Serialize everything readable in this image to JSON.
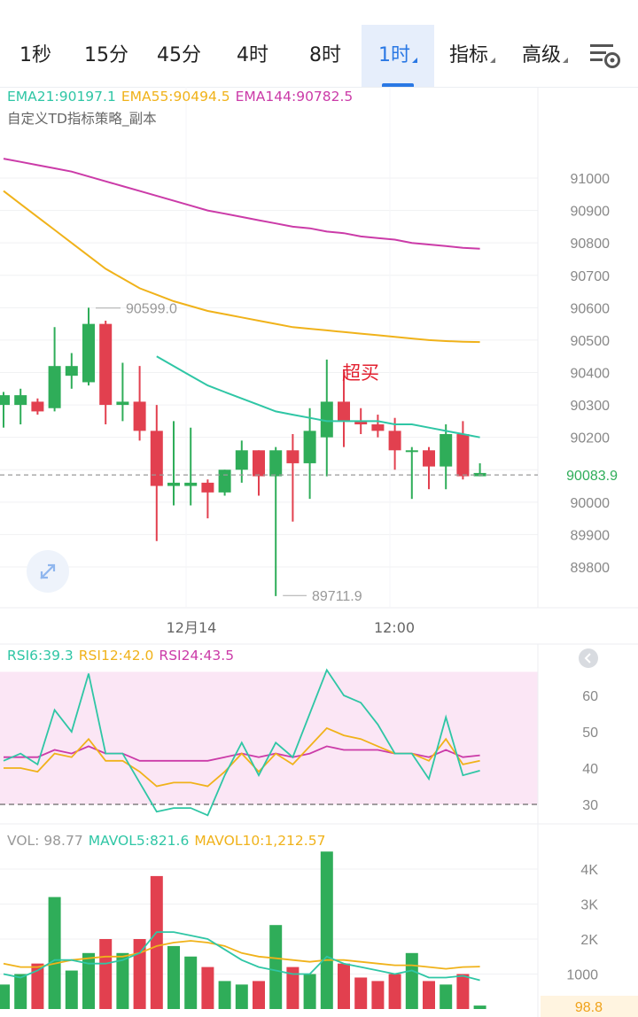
{
  "tabs": [
    {
      "label": "1秒",
      "active": false,
      "dropdown": false
    },
    {
      "label": "15分",
      "active": false,
      "dropdown": false
    },
    {
      "label": "45分",
      "active": false,
      "dropdown": false
    },
    {
      "label": "4时",
      "active": false,
      "dropdown": false
    },
    {
      "label": "8时",
      "active": false,
      "dropdown": false
    },
    {
      "label": "1时",
      "active": true,
      "dropdown": true
    },
    {
      "label": "指标",
      "active": false,
      "dropdown": true
    },
    {
      "label": "高级",
      "active": false,
      "dropdown": true
    }
  ],
  "settings_icon": "chart-settings-icon",
  "main_legend": {
    "ema21": "EMA21:90197.1",
    "ema55": "EMA55:90494.5",
    "ema144": "EMA144:90782.5",
    "strategy": "自定义TD指标策略_副本"
  },
  "colors": {
    "up": "#2fad59",
    "down": "#e2404f",
    "ema21": "#2fc6a5",
    "ema55": "#f0b21a",
    "ema144": "#cb3ba8",
    "accent": "#2a78e4",
    "rsi_band": "#fbe6f5"
  },
  "annotations": {
    "high_label": "90599.0",
    "low_label": "89711.9",
    "overbought": "超买",
    "last_price": "90083.9"
  },
  "x_labels": [
    "12月14",
    "12:00"
  ],
  "rsi_legend": {
    "rsi6": "RSI6:39.3",
    "rsi12": "RSI12:42.0",
    "rsi24": "RSI24:43.5"
  },
  "vol_legend": {
    "vol": "VOL: 98.77",
    "mavol5": "MAVOL5:821.6",
    "mavol10": "MAVOL10:1,212.57"
  },
  "current_volume": "98.8",
  "chart_data": {
    "type": "candlestick",
    "price_axis": {
      "ticks": [
        "91000",
        "90900",
        "90800",
        "90700",
        "90600",
        "90500",
        "90400",
        "90300",
        "90200",
        "90100",
        "90000",
        "89900",
        "89800"
      ],
      "range": [
        89650,
        91150
      ]
    },
    "candles": [
      {
        "o": 90300,
        "h": 90340,
        "l": 90230,
        "c": 90330
      },
      {
        "o": 90300,
        "h": 90350,
        "l": 90240,
        "c": 90330
      },
      {
        "o": 90310,
        "h": 90320,
        "l": 90270,
        "c": 90280
      },
      {
        "o": 90290,
        "h": 90540,
        "l": 90280,
        "c": 90420
      },
      {
        "o": 90390,
        "h": 90460,
        "l": 90350,
        "c": 90420
      },
      {
        "o": 90370,
        "h": 90600,
        "l": 90360,
        "c": 90550
      },
      {
        "o": 90550,
        "h": 90560,
        "l": 90240,
        "c": 90300
      },
      {
        "o": 90300,
        "h": 90430,
        "l": 90250,
        "c": 90310
      },
      {
        "o": 90310,
        "h": 90420,
        "l": 90190,
        "c": 90220
      },
      {
        "o": 90220,
        "h": 90300,
        "l": 89880,
        "c": 90050
      },
      {
        "o": 90050,
        "h": 90250,
        "l": 89990,
        "c": 90060
      },
      {
        "o": 90050,
        "h": 90230,
        "l": 89990,
        "c": 90060
      },
      {
        "o": 90060,
        "h": 90070,
        "l": 89950,
        "c": 90030
      },
      {
        "o": 90030,
        "h": 90100,
        "l": 90020,
        "c": 90100
      },
      {
        "o": 90100,
        "h": 90190,
        "l": 90060,
        "c": 90160
      },
      {
        "o": 90160,
        "h": 90160,
        "l": 90020,
        "c": 90080
      },
      {
        "o": 90080,
        "h": 90170,
        "l": 89710,
        "c": 90160
      },
      {
        "o": 90160,
        "h": 90210,
        "l": 89940,
        "c": 90120
      },
      {
        "o": 90120,
        "h": 90290,
        "l": 90010,
        "c": 90220
      },
      {
        "o": 90200,
        "h": 90440,
        "l": 90080,
        "c": 90310
      },
      {
        "o": 90310,
        "h": 90410,
        "l": 90170,
        "c": 90250
      },
      {
        "o": 90250,
        "h": 90290,
        "l": 90210,
        "c": 90240
      },
      {
        "o": 90240,
        "h": 90270,
        "l": 90200,
        "c": 90220
      },
      {
        "o": 90220,
        "h": 90260,
        "l": 90100,
        "c": 90160
      },
      {
        "o": 90160,
        "h": 90170,
        "l": 90010,
        "c": 90160
      },
      {
        "o": 90160,
        "h": 90170,
        "l": 90040,
        "c": 90110
      },
      {
        "o": 90110,
        "h": 90240,
        "l": 90040,
        "c": 90210
      },
      {
        "o": 90210,
        "h": 90250,
        "l": 90070,
        "c": 90080
      },
      {
        "o": 90080,
        "h": 90120,
        "l": 90080,
        "c": 90090
      }
    ],
    "ema21": [
      null,
      null,
      null,
      null,
      null,
      null,
      null,
      null,
      null,
      90450,
      90420,
      90390,
      90360,
      90340,
      90320,
      90300,
      90280,
      90270,
      90260,
      90250,
      90250,
      90250,
      90250,
      90240,
      90240,
      90230,
      90220,
      90210,
      90200
    ],
    "ema55": [
      90960,
      90920,
      90880,
      90840,
      90800,
      90760,
      90720,
      90690,
      90660,
      90640,
      90620,
      90605,
      90590,
      90580,
      90570,
      90560,
      90550,
      90540,
      90535,
      90530,
      90525,
      90520,
      90515,
      90510,
      90505,
      90500,
      90497,
      90495,
      90494
    ],
    "ema144": [
      91060,
      91050,
      91040,
      91030,
      91020,
      91005,
      90990,
      90975,
      90960,
      90945,
      90930,
      90915,
      90900,
      90890,
      90880,
      90870,
      90860,
      90850,
      90845,
      90835,
      90830,
      90820,
      90815,
      90810,
      90800,
      90795,
      90790,
      90785,
      90782
    ],
    "rsi_axis": {
      "ticks": [
        "60",
        "50",
        "40",
        "30"
      ],
      "range": [
        25,
        70
      ]
    },
    "rsi6": [
      42,
      44,
      41,
      56,
      50,
      66,
      44,
      44,
      36,
      28,
      29,
      29,
      27,
      38,
      47,
      38,
      47,
      43,
      55,
      67,
      60,
      58,
      52,
      44,
      44,
      37,
      54,
      38,
      39.3
    ],
    "rsi12": [
      40,
      40,
      39,
      44,
      43,
      48,
      42,
      42,
      39,
      35,
      36,
      36,
      35,
      39,
      44,
      39,
      44,
      41,
      46,
      51,
      49,
      48,
      46,
      44,
      44,
      42,
      48,
      41,
      42.0
    ],
    "rsi24": [
      43,
      43,
      43,
      45,
      44,
      46,
      44,
      44,
      42,
      42,
      42,
      42,
      42,
      43,
      44,
      43,
      44,
      43,
      44,
      46,
      45,
      45,
      45,
      44,
      44,
      43,
      45,
      43,
      43.5
    ],
    "vol_axis": {
      "ticks": [
        "4K",
        "3K",
        "2K",
        "1000"
      ],
      "range": [
        0,
        4700
      ]
    },
    "volume": [
      700,
      1000,
      1300,
      3200,
      1100,
      1600,
      2000,
      1600,
      2000,
      3800,
      1800,
      1500,
      1200,
      800,
      700,
      800,
      2400,
      1200,
      1000,
      4500,
      1300,
      900,
      800,
      1000,
      1600,
      800,
      700,
      1000,
      98.77
    ],
    "mavol5": [
      1000,
      900,
      1100,
      1400,
      1400,
      1300,
      1300,
      1400,
      1600,
      2200,
      2200,
      2100,
      2000,
      1700,
      1400,
      1200,
      1100,
      1000,
      1000,
      1500,
      1300,
      1200,
      1100,
      1000,
      1100,
      900,
      900,
      950,
      821.6
    ],
    "mavol10": [
      1300,
      1200,
      1200,
      1300,
      1400,
      1450,
      1500,
      1500,
      1600,
      1800,
      1900,
      1950,
      1900,
      1800,
      1600,
      1500,
      1450,
      1400,
      1350,
      1400,
      1400,
      1350,
      1300,
      1250,
      1250,
      1200,
      1150,
      1200,
      1212.57
    ]
  }
}
